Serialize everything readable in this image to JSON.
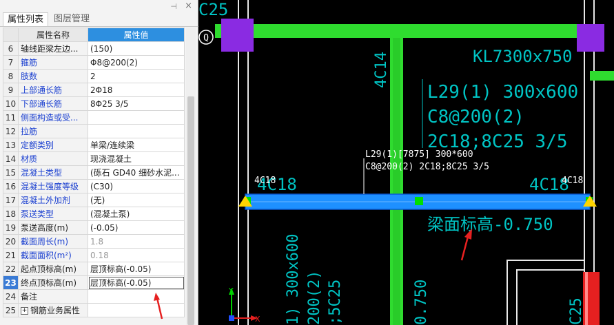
{
  "panel": {
    "tabs": [
      {
        "label": "属性列表"
      },
      {
        "label": "图层管理"
      }
    ],
    "columns": {
      "name": "属性名称",
      "value": "属性值"
    },
    "rows": [
      {
        "num": "6",
        "name": "轴线距梁左边...",
        "value": "(150)",
        "name_color": "black"
      },
      {
        "num": "7",
        "name": "箍筋",
        "value": "Φ8@200(2)",
        "name_color": "blue"
      },
      {
        "num": "8",
        "name": "肢数",
        "value": "2",
        "name_color": "blue"
      },
      {
        "num": "9",
        "name": "上部通长筋",
        "value": "2Φ18",
        "name_color": "blue"
      },
      {
        "num": "10",
        "name": "下部通长筋",
        "value": "8Φ25 3/5",
        "name_color": "blue"
      },
      {
        "num": "11",
        "name": "侧面构造或受...",
        "value": "",
        "name_color": "blue"
      },
      {
        "num": "12",
        "name": "拉筋",
        "value": "",
        "name_color": "blue"
      },
      {
        "num": "13",
        "name": "定额类别",
        "value": "单梁/连续梁",
        "name_color": "blue"
      },
      {
        "num": "14",
        "name": "材质",
        "value": "现浇混凝土",
        "name_color": "blue"
      },
      {
        "num": "15",
        "name": "混凝土类型",
        "value": "(砾石 GD40 细砂水泥...",
        "name_color": "blue"
      },
      {
        "num": "16",
        "name": "混凝土强度等级",
        "value": "(C30)",
        "name_color": "blue"
      },
      {
        "num": "17",
        "name": "混凝土外加剂",
        "value": "(无)",
        "name_color": "blue"
      },
      {
        "num": "18",
        "name": "泵送类型",
        "value": "(混凝土泵)",
        "name_color": "blue"
      },
      {
        "num": "19",
        "name": "泵送高度(m)",
        "value": "(-0.05)",
        "name_color": "black"
      },
      {
        "num": "20",
        "name": "截面周长(m)",
        "value": "1.8",
        "name_color": "blue",
        "value_muted": true
      },
      {
        "num": "21",
        "name": "截面面积(m²)",
        "value": "0.18",
        "name_color": "blue",
        "value_muted": true
      },
      {
        "num": "22",
        "name": "起点顶标高(m)",
        "value": "层顶标高(-0.05)",
        "name_color": "black"
      },
      {
        "num": "23",
        "name": "终点顶标高(m)",
        "value": "层顶标高(-0.05)",
        "name_color": "black",
        "selected": true
      },
      {
        "num": "24",
        "name": "备注",
        "value": "",
        "name_color": "black"
      },
      {
        "num": "25",
        "name": "钢筋业务属性",
        "value": "",
        "name_color": "black",
        "expandable": true
      }
    ]
  },
  "canvas": {
    "axis_bubble": "Q",
    "texts": {
      "top_left_frag": "C25",
      "beam_top": "4C14",
      "kl_label": "KL7300x750",
      "l29_line1": "L29(1) 300x600",
      "l29_line2": "C8@200(2)",
      "l29_line3": "2C18;8C25 3/5",
      "tip_line1": "L29(1)[7875] 300*600",
      "tip_line2": "C8@200(2) 2C18;8C25 3/5",
      "left_4c18": "4C18",
      "left_4c18_small": "4C18",
      "right_4c18": "4C18",
      "right_4c18_small": "4C18",
      "elev": "梁面标高-0.750",
      "v_text1": "1) 300x600",
      "v_text2": "200(2)",
      "v_text3": ";5C25",
      "v_text4": "0.750",
      "v_text5": "C25",
      "axis_y": "Y",
      "axis_x": "X"
    }
  },
  "colors": {
    "beam_blue": "#1e90ff",
    "column_purple": "#8a2be2",
    "green_beam": "#2fdc2f",
    "cad_cyan": "#00c4c4",
    "annotation_red": "#e62020",
    "header_blue": "#2d8fe0",
    "name_blue": "#1a3fd0"
  }
}
